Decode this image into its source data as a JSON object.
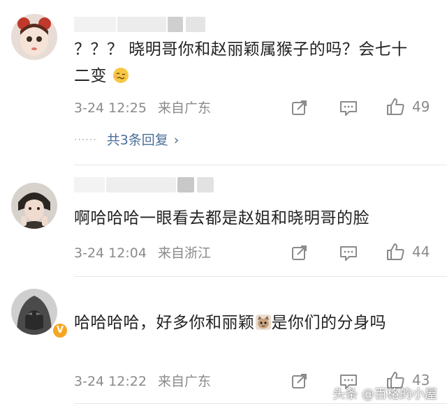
{
  "comments": [
    {
      "text": "？？？ 晓明哥你和赵丽颖属猴子的吗？会七十二变",
      "emoji": "woozy-face-emoji",
      "time": "3-24 12:25",
      "location": "来自广东",
      "likes": "49",
      "replies_label": "共3条回复",
      "replies_chevron": "›"
    },
    {
      "text": "啊哈哈哈一眼看去都是赵姐和晓明哥的脸",
      "time": "3-24 12:04",
      "location": "来自浙江",
      "likes": "44"
    },
    {
      "text_before": "哈哈哈哈，好多你和丽颖",
      "emoji": "cat-emoji",
      "text_after": "是你们的分身吗",
      "time": "3-24 12:22",
      "location": "来自广东",
      "likes": "43",
      "verified_badge": "V"
    }
  ],
  "watermark": "头条 @百格的小屋",
  "colors": {
    "meta": "#8a8a8a",
    "reply_link": "#4a6d9a",
    "verified": "#f5a623"
  }
}
